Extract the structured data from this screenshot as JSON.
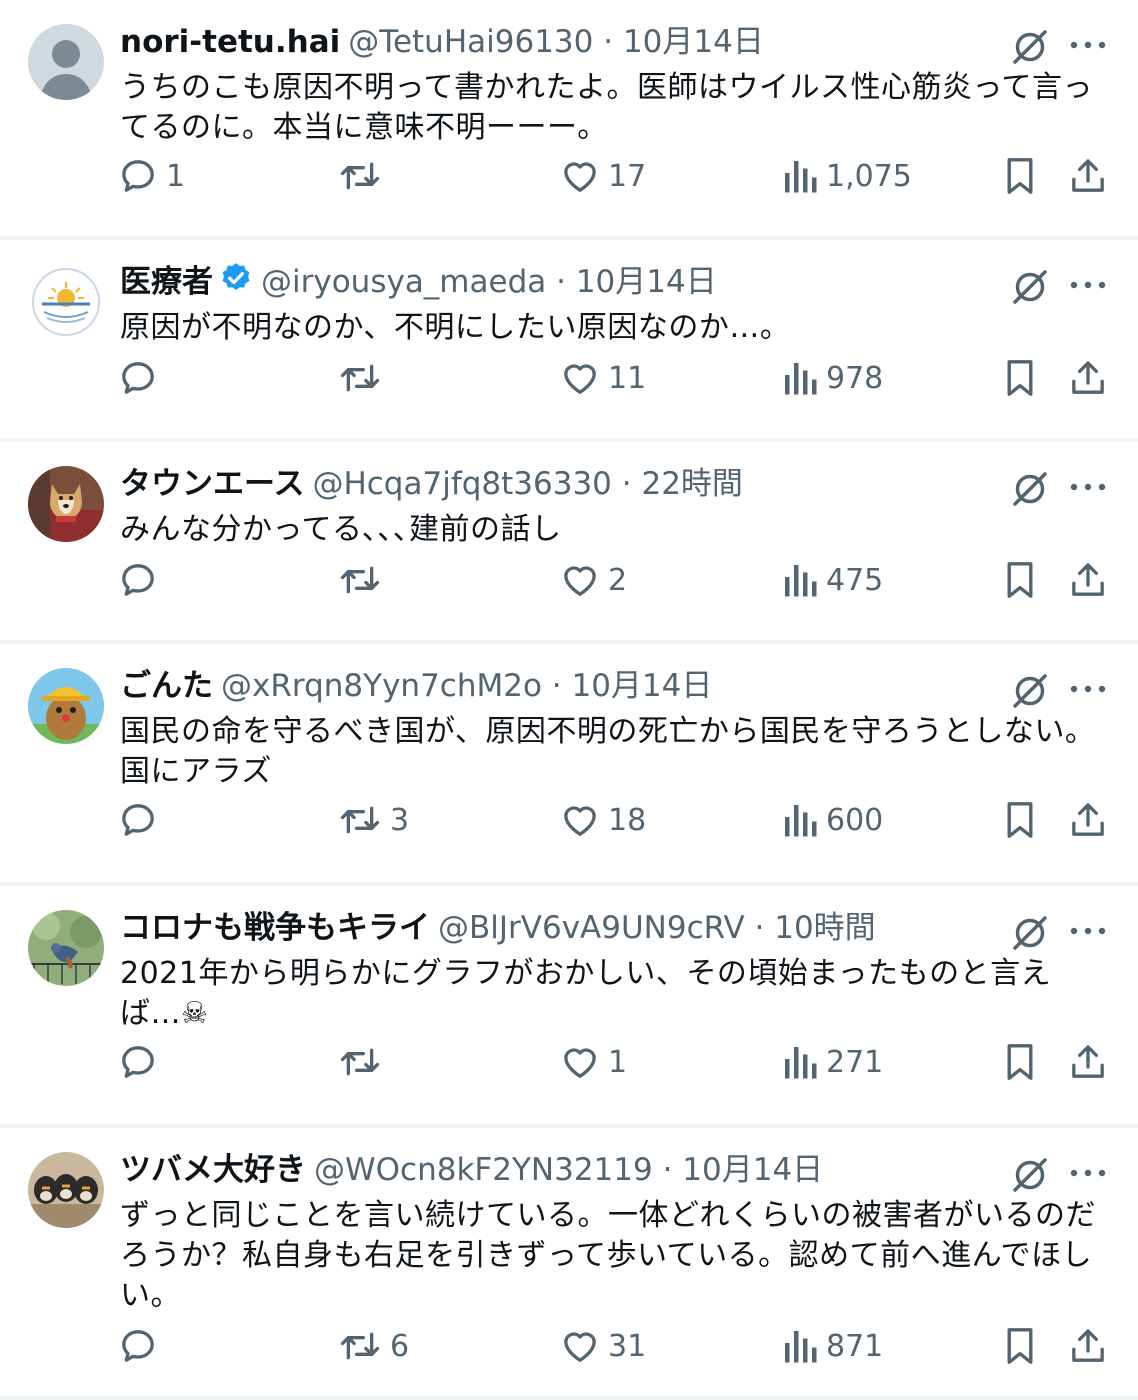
{
  "tweets": [
    {
      "name": "nori-tetu.hai",
      "handle": "@TetuHai96130",
      "time": "10月14日",
      "verified": false,
      "avatar": "default-avatar",
      "text": "うちのこも原因不明って書かれたよ。医師はウイルス性心筋炎って言ってるのに。本当に意味不明ーーー。",
      "replies": "1",
      "retweets": "",
      "likes": "17",
      "views": "1,075"
    },
    {
      "name": "医療者",
      "handle": "@iryousya_maeda",
      "time": "10月14日",
      "verified": true,
      "avatar": "sunrise-logo-avatar",
      "text": "原因が不明なのか、不明にしたい原因なのか…。",
      "replies": "",
      "retweets": "",
      "likes": "11",
      "views": "978"
    },
    {
      "name": "タウンエース",
      "handle": "@Hcqa7jfq8t36330",
      "time": "22時間",
      "verified": false,
      "avatar": "dog-photo-avatar",
      "text": "みんな分かってる､､､建前の話し",
      "replies": "",
      "retweets": "",
      "likes": "2",
      "views": "475"
    },
    {
      "name": "ごんた",
      "handle": "@xRrqn8Yyn7chM2o",
      "time": "10月14日",
      "verified": false,
      "avatar": "cartoon-character-avatar",
      "text": "国民の命を守るべき国が、原因不明の死亡から国民を守ろうとしない。国にアラズ",
      "replies": "",
      "retweets": "3",
      "likes": "18",
      "views": "600"
    },
    {
      "name": "コロナも戦争もキライ",
      "handle": "@BlJrV6vA9UN9cRV",
      "time": "10時間",
      "verified": false,
      "avatar": "bird-photo-avatar",
      "text": "2021年から明らかにグラフがおかしい、その頃始まったものと言えば…",
      "emoji": "☠",
      "replies": "",
      "retweets": "",
      "likes": "1",
      "views": "271"
    },
    {
      "name": "ツバメ大好き",
      "handle": "@WOcn8kF2YN32119",
      "time": "10月14日",
      "verified": false,
      "avatar": "swallows-photo-avatar",
      "text": "ずっと同じことを言い続けている。一体どれくらいの被害者がいるのだろうか？私自身も右足を引きずって歩いている。認めて前へ進んでほしい。",
      "replies": "",
      "retweets": "6",
      "likes": "31",
      "views": "871"
    }
  ],
  "colors": {
    "secondary_text": "#536471",
    "verified_blue": "#1d9bf0",
    "divider": "#eff3f4"
  }
}
